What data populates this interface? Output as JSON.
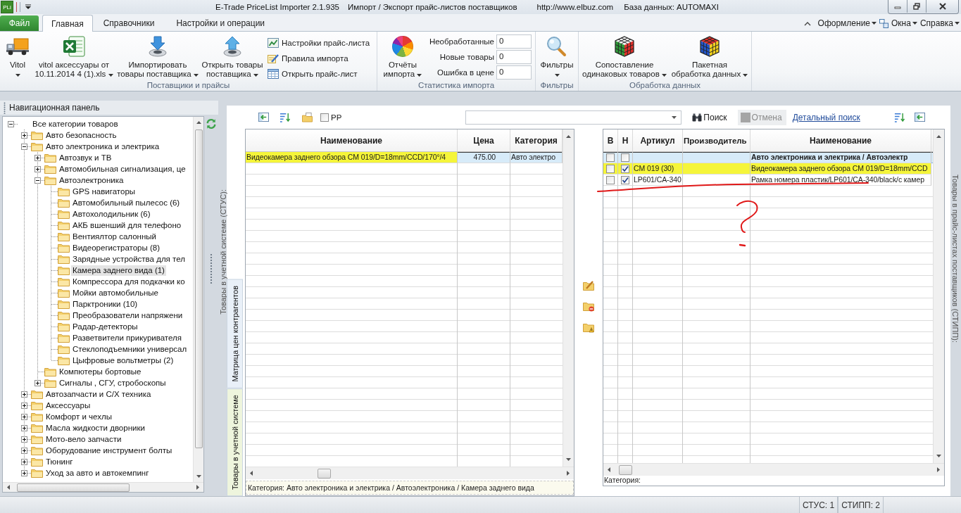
{
  "window": {
    "logo_text": "PLi",
    "app_name": "E-Trade PriceList Importer 2.1.935",
    "title": "Импорт / Экспорт прайс-листов поставщиков",
    "website": "http://www.elbuz.com",
    "database": "База данных: AUTOMAXI"
  },
  "ribbon": {
    "file_tab": "Файл",
    "tabs": [
      {
        "label": "Главная",
        "selected": true
      },
      {
        "label": "Справочники",
        "selected": false
      },
      {
        "label": "Настройки и операции",
        "selected": false
      }
    ],
    "menus": [
      {
        "label": "Оформление",
        "dropdown": true
      },
      {
        "label": "Окна",
        "dropdown": true
      },
      {
        "label": "Справка",
        "dropdown": true
      }
    ],
    "groups": [
      {
        "label": "Поставщики и прайсы",
        "large_buttons": [
          {
            "label": "Vitol",
            "dropdown": true
          },
          {
            "label": "vitol аксессуары от\n10.11.2014 4 (1).xls",
            "dropdown": true
          },
          {
            "label": "Импортировать\nтовары поставщика",
            "dropdown": true
          },
          {
            "label": "Открыть товары\nпоставщика",
            "dropdown": true
          }
        ],
        "small_buttons": [
          "Настройки прайс-листа",
          "Правила импорта",
          "Открыть прайс-лист"
        ]
      },
      {
        "label": "Статистика импорта",
        "large_buttons": [
          {
            "label": "Отчёты\nимпорта",
            "dropdown": true
          }
        ],
        "counters": [
          {
            "label": "Необработанные",
            "value": "0"
          },
          {
            "label": "Новые товары",
            "value": "0"
          },
          {
            "label": "Ошибка в цене",
            "value": "0"
          }
        ]
      },
      {
        "label": "Фильтры",
        "large_buttons": [
          {
            "label": "Фильтры",
            "dropdown": true
          }
        ]
      },
      {
        "label": "Обработка данных",
        "large_buttons": [
          {
            "label": "Сопоставление\nодинаковых товаров",
            "dropdown": true
          },
          {
            "label": "Пакетная\nобработка данных",
            "dropdown": true
          }
        ]
      }
    ]
  },
  "navigation": {
    "title": "Навигационная панель",
    "tree": [
      {
        "label": "Все категории товаров",
        "expanded": true,
        "selected": false,
        "children": [
          {
            "label": "Авто безопасность",
            "expanded": false,
            "selected": false
          },
          {
            "label": "Авто электроника и электрика",
            "expanded": true,
            "selected": false,
            "children": [
              {
                "label": "Автозвук и ТВ",
                "expanded": false,
                "selected": false
              },
              {
                "label": "Автомобильная сигнализация, це",
                "expanded": false,
                "selected": false
              },
              {
                "label": "Автоэлектроника",
                "expanded": true,
                "selected": false,
                "children": [
                  {
                    "label": "GPS навигаторы",
                    "selected": false
                  },
                  {
                    "label": "Автомобильный пылесос (6)",
                    "selected": false
                  },
                  {
                    "label": "Автохолодильник (6)",
                    "selected": false
                  },
                  {
                    "label": "АКБ вшенший для телефоно",
                    "selected": false
                  },
                  {
                    "label": "Вентиялтор салонный",
                    "selected": false
                  },
                  {
                    "label": "Видеорегистраторы (8)",
                    "selected": false
                  },
                  {
                    "label": "Зарядные устройства для тел",
                    "selected": false
                  },
                  {
                    "label": "Камера заднего вида (1)",
                    "selected": true
                  },
                  {
                    "label": "Компрессора для подкачки ко",
                    "selected": false
                  },
                  {
                    "label": "Мойки автомобильные",
                    "selected": false
                  },
                  {
                    "label": "Парктроники (10)",
                    "selected": false
                  },
                  {
                    "label": "Преобразователи напряжени",
                    "selected": false
                  },
                  {
                    "label": "Радар-детекторы",
                    "selected": false
                  },
                  {
                    "label": "Разветвители прикуривателя",
                    "selected": false
                  },
                  {
                    "label": "Стеклоподъемники универсал",
                    "selected": false
                  },
                  {
                    "label": "Цыфровые вольтметры (2)",
                    "selected": false
                  }
                ]
              },
              {
                "label": "Компютеры бортовые",
                "selected": false
              },
              {
                "label": "Сигналы , СГУ, стробоскопы",
                "expanded": false,
                "selected": false
              }
            ]
          },
          {
            "label": "Автозапчасти и С/Х техника",
            "expanded": false,
            "selected": false
          },
          {
            "label": "Аксессуары",
            "expanded": false,
            "selected": false
          },
          {
            "label": "Комфорт и чехлы",
            "expanded": false,
            "selected": false
          },
          {
            "label": "Масла жидкости дворники",
            "expanded": false,
            "selected": false
          },
          {
            "label": "Мото-вело запчасти",
            "expanded": false,
            "selected": false
          },
          {
            "label": "Оборудование инструмент болты",
            "expanded": false,
            "selected": false
          },
          {
            "label": "Тюнинг",
            "expanded": false,
            "selected": false
          },
          {
            "label": "Уход за авто и автокемпинг",
            "expanded": false,
            "selected": false
          }
        ]
      }
    ]
  },
  "content": {
    "side_label": "Товары в учетной системе (СТУС):",
    "side_tabs": [
      {
        "label": "Матрица цен контрагентов",
        "selected": false
      },
      {
        "label": "Товары в учетной системе",
        "selected": true
      }
    ],
    "toolbar": {
      "pp_checkbox": {
        "label": "PP",
        "checked": false
      },
      "search_button": "Поиск",
      "cancel_button": {
        "label": "Отмена",
        "disabled": true
      },
      "detail_search_link": "Детальный поиск"
    },
    "system_grid": {
      "columns": [
        "Наименование",
        "Цена",
        "Категория"
      ],
      "rows": [
        {
          "name": "Видеокамера заднего обзора CM 019/D=18mm/CCD/170°/4",
          "price": "475.00",
          "category": "Авто электро",
          "selected": true,
          "marker_highlight": true
        }
      ],
      "footer": "Категория: Авто электроника и электрика / Автоэлектроника / Камера заднего вида"
    },
    "supplier_grid": {
      "columns": [
        "В",
        "Н",
        "Артикул",
        "Производитель",
        "Наименование"
      ],
      "rows": [
        {
          "kind": "group",
          "column_v_checked": false,
          "column_n_checked": false,
          "name": "Авто электроника и электрика / Автоэлектр",
          "selected": true,
          "marker_highlight": false
        },
        {
          "kind": "item",
          "column_v_checked": false,
          "column_n_checked": true,
          "article": "CM 019 (30)",
          "name": "Видеокамера заднего обзора CM 019/D=18mm/CCD",
          "selected": false,
          "marker_highlight": true
        },
        {
          "kind": "item",
          "column_v_checked": false,
          "column_n_checked": true,
          "article": "LP601/CA-340",
          "name": "Рамка номера пластик/LP601/CA-340/black/с камер",
          "selected": false,
          "marker_highlight": false
        }
      ],
      "footer": "Категория:"
    },
    "supplier_side_label": "Товары в прайс-листах поставщиков (СТИПП):"
  },
  "status_bar": [
    "СТУС: 1",
    "СТИПП: 2"
  ]
}
